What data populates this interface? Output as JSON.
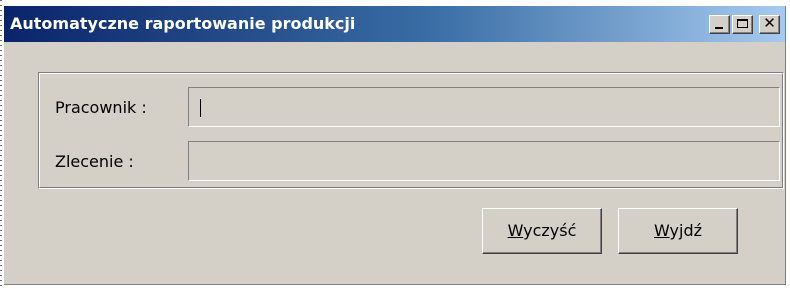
{
  "window": {
    "title": "Automatyczne raportowanie produkcji",
    "controls": {
      "minimize_icon": "minimize-icon",
      "maximize_icon": "maximize-icon",
      "close_icon": "close-icon",
      "close_glyph": "✕"
    }
  },
  "form": {
    "pracownik_label": "Pracownik :",
    "pracownik_value": "",
    "zlecenie_label": "Zlecenie :",
    "zlecenie_value": ""
  },
  "buttons": {
    "clear": {
      "mnemonic": "W",
      "rest": "yczyść"
    },
    "exit": {
      "mnemonic": "W",
      "rest": "yjdź"
    }
  },
  "colors": {
    "titlebar_start": "#0a246a",
    "titlebar_end": "#a6caf0",
    "face": "#d4d0c8"
  }
}
